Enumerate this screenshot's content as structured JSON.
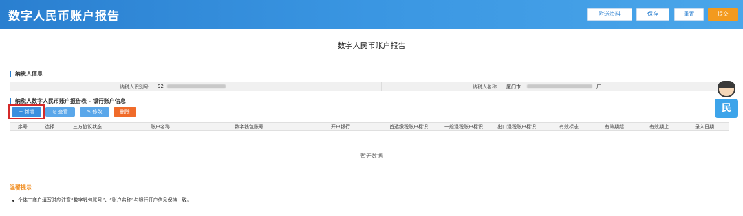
{
  "header": {
    "title": "数字人民币账户报告",
    "buttons": {
      "attach": "附送资料",
      "save": "保存",
      "reset": "重置",
      "submit": "提交"
    }
  },
  "page_title": "数字人民币账户报告",
  "taxpayer_section": {
    "title": "纳税人信息",
    "id_label": "纳税人识别号",
    "id_value_prefix": "92",
    "name_label": "纳税人名称",
    "name_value_prefix": "厦门市",
    "name_value_suffix": "厂"
  },
  "account_section": {
    "title": "纳税人数字人民币账户报告表 - 银行账户信息",
    "buttons": {
      "add": "+ 新增",
      "view": "◎ 查看",
      "edit": "✎ 修改",
      "delete": "删除"
    },
    "columns": [
      "序号",
      "选择",
      "三方协议状态",
      "账户名称",
      "数字钱包账号",
      "开户银行",
      "首选缴税账户标识",
      "一般退税账户标识",
      "出口退税账户标识",
      "有效标志",
      "有效期起",
      "有效期止",
      "录入日期"
    ],
    "empty_text": "暂无数据"
  },
  "tips": {
    "title": "温馨提示",
    "items": [
      "个体工商户填写时应注意“数字钱包账号”、“账户名称”与银行开户信息保持一致。"
    ]
  },
  "assistant": {
    "badge_glyph": "民"
  },
  "colors": {
    "header_blue": "#2a7fd0",
    "submit_orange": "#f39a1e",
    "delete_orange": "#f06b2a",
    "tip_orange": "#f08c1e",
    "highlight_red": "#d42a2a"
  }
}
